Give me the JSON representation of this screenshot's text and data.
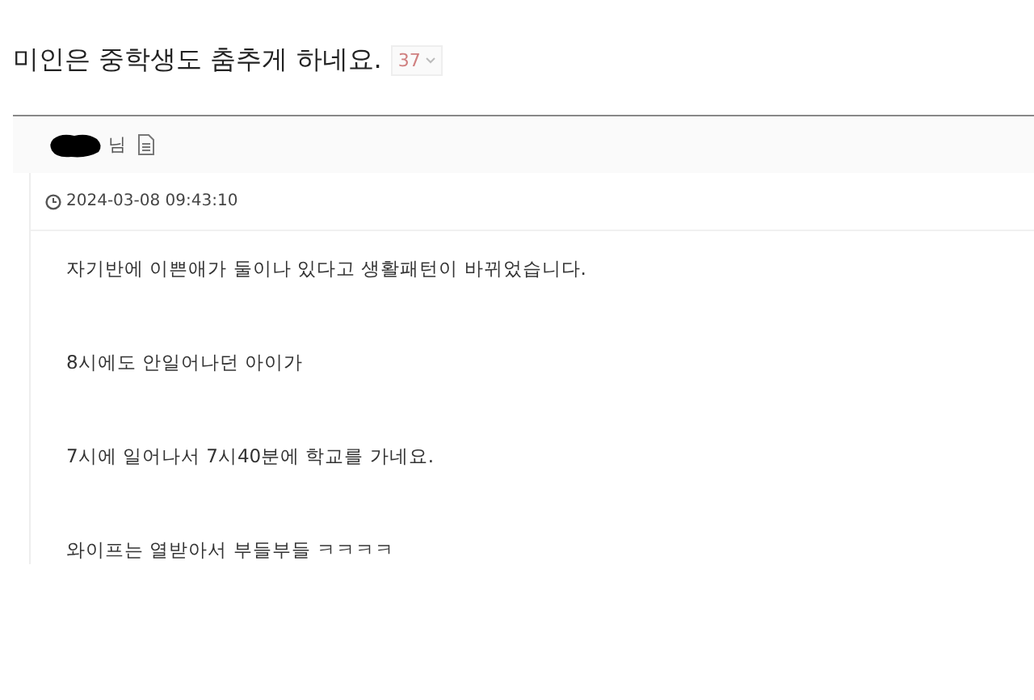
{
  "post": {
    "title": "미인은 중학생도 춤추게 하네요.",
    "comment_count": "37",
    "author_suffix": "님",
    "date": "2024-03-08 09:43:10",
    "paragraphs": [
      "자기반에 이쁜애가 둘이나 있다고 생활패턴이 바뀌었습니다.",
      "8시에도 안일어나던 아이가",
      "7시에 일어나서 7시40분에 학교를 가네요.",
      "와이프는 열받아서 부들부들 ㅋㅋㅋㅋ"
    ]
  }
}
